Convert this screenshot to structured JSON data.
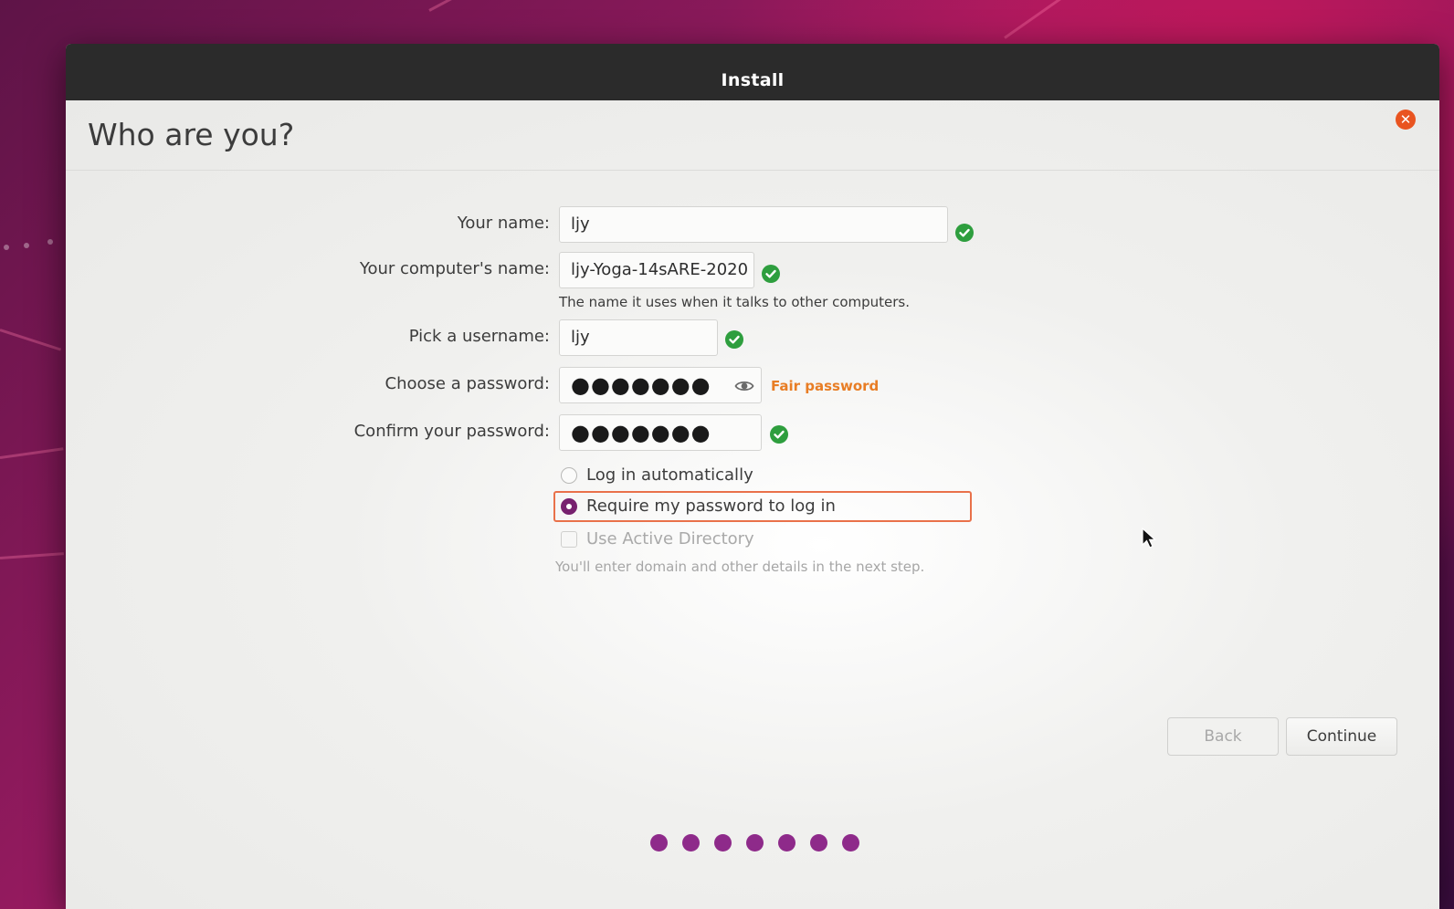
{
  "window": {
    "title": "Install"
  },
  "page": {
    "title": "Who are you?"
  },
  "form": {
    "name_label": "Your name:",
    "name_value": "ljy",
    "computer_label": "Your computer's name:",
    "computer_value": "ljy-Yoga-14sARE-2020",
    "computer_hint": "The name it uses when it talks to other computers.",
    "username_label": "Pick a username:",
    "username_value": "ljy",
    "password_label": "Choose a password:",
    "password_value": "●●●●●●●",
    "password_strength": "Fair password",
    "confirm_label": "Confirm your password:",
    "confirm_value": "●●●●●●●"
  },
  "options": {
    "auto_login_label": "Log in automatically",
    "require_password_label": "Require my password to log in",
    "active_directory_label": "Use Active Directory",
    "active_directory_hint": "You'll enter domain and other details in the next step.",
    "selected": "Require my password to log in"
  },
  "buttons": {
    "back_label": "Back",
    "continue_label": "Continue"
  },
  "progress": {
    "steps_total": 7,
    "steps_completed": 7
  },
  "colors": {
    "accent": "#77216f",
    "success": "#2e9e3e",
    "warning": "#e87d25",
    "close": "#e95420",
    "titlebar": "#2b2b2b"
  },
  "icons": {
    "valid": "check-circle-icon",
    "reveal": "eye-icon",
    "close": "close-icon"
  }
}
